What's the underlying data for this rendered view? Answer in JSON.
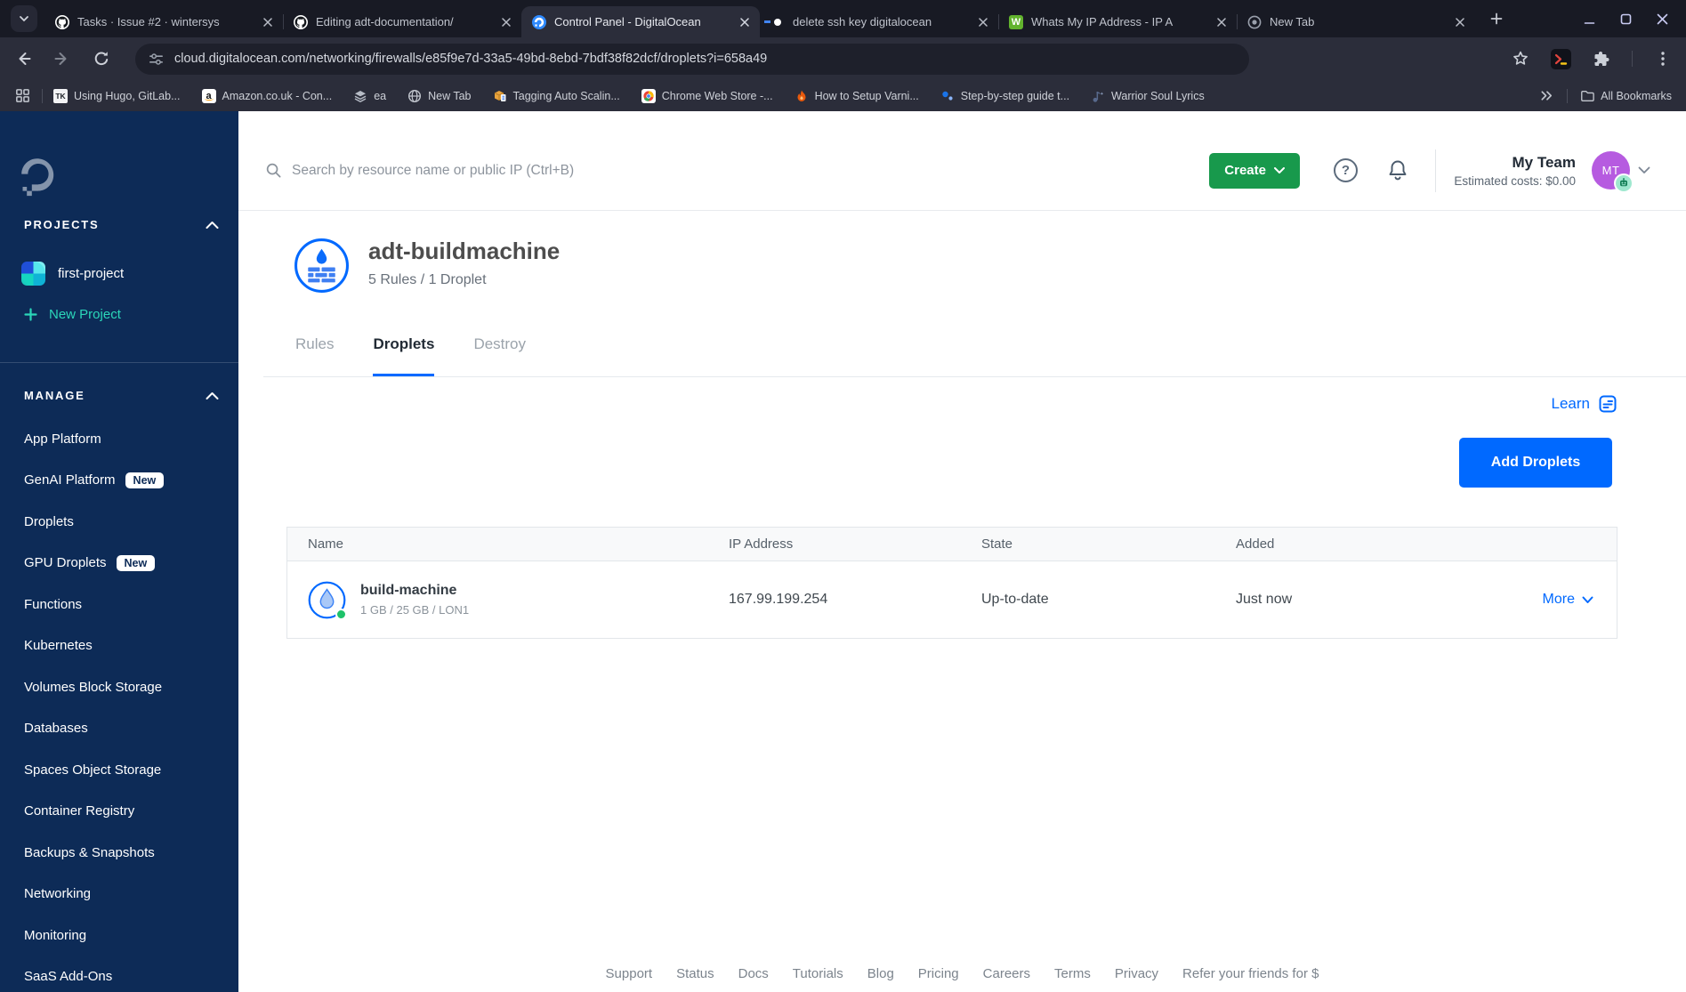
{
  "browser": {
    "tabs": [
      {
        "title": "Tasks · Issue #2 · wintersys",
        "icon": "github"
      },
      {
        "title": "Editing adt-documentation/",
        "icon": "github"
      },
      {
        "title": "Control Panel - DigitalOcean",
        "icon": "digitalocean"
      },
      {
        "title": "delete ssh key digitalocean",
        "icon": "google"
      },
      {
        "title": "Whats My IP Address - IP A",
        "icon": "whatsmyipaddress",
        "icon_text": "W"
      },
      {
        "title": "New Tab",
        "icon": "chrome"
      }
    ],
    "address": {
      "url": "cloud.digitalocean.com/networking/firewalls/e85f9e7d-33a5-49bd-8ebd-7bdf38f82dcf/droplets?i=658a49"
    },
    "bookmarks": [
      {
        "label": "Using Hugo, GitLab...",
        "icon_text": "TK"
      },
      {
        "label": "Amazon.co.uk - Con...",
        "icon_text": "a"
      },
      {
        "label": "ea"
      },
      {
        "label": "New Tab"
      },
      {
        "label": "Tagging Auto Scalin..."
      },
      {
        "label": "Chrome Web Store -..."
      },
      {
        "label": "How to Setup Varni..."
      },
      {
        "label": "Step-by-step guide t..."
      },
      {
        "label": "Warrior Soul Lyrics"
      }
    ],
    "all_bookmarks_label": "All Bookmarks"
  },
  "sidebar": {
    "projects_header": "PROJECTS",
    "project_name": "first-project",
    "new_project_label": "New Project",
    "manage_header": "MANAGE",
    "items": [
      {
        "label": "App Platform"
      },
      {
        "label": "GenAI Platform",
        "badge": "New"
      },
      {
        "label": "Droplets"
      },
      {
        "label": "GPU Droplets",
        "badge": "New"
      },
      {
        "label": "Functions"
      },
      {
        "label": "Kubernetes"
      },
      {
        "label": "Volumes Block Storage"
      },
      {
        "label": "Databases"
      },
      {
        "label": "Spaces Object Storage"
      },
      {
        "label": "Container Registry"
      },
      {
        "label": "Backups & Snapshots"
      },
      {
        "label": "Networking"
      },
      {
        "label": "Monitoring"
      },
      {
        "label": "SaaS Add-Ons"
      }
    ]
  },
  "topbar": {
    "search_placeholder": "Search by resource name or public IP (Ctrl+B)",
    "create_label": "Create",
    "team_name": "My Team",
    "estimated_costs": "Estimated costs: $0.00",
    "avatar_initials": "MT"
  },
  "page": {
    "title": "adt-buildmachine",
    "subtitle": "5 Rules / 1 Droplet",
    "tabs": [
      "Rules",
      "Droplets",
      "Destroy"
    ],
    "learn_label": "Learn",
    "add_droplets_label": "Add Droplets"
  },
  "table": {
    "headers": [
      "Name",
      "IP Address",
      "State",
      "Added"
    ],
    "rows": [
      {
        "name": "build-machine",
        "specs": "1 GB / 25 GB / LON1",
        "ip": "167.99.199.254",
        "state": "Up-to-date",
        "added": "Just now",
        "more_label": "More"
      }
    ]
  },
  "footer": {
    "links": [
      "Support",
      "Status",
      "Docs",
      "Tutorials",
      "Blog",
      "Pricing",
      "Careers",
      "Terms",
      "Privacy",
      "Refer your friends for $"
    ]
  },
  "colors": {
    "do_blue": "#0069ff",
    "create_green": "#18994c",
    "sidebar_navy": "#0d2b57",
    "teal": "#2bd6b9",
    "avatar_purple": "#b65be0"
  }
}
